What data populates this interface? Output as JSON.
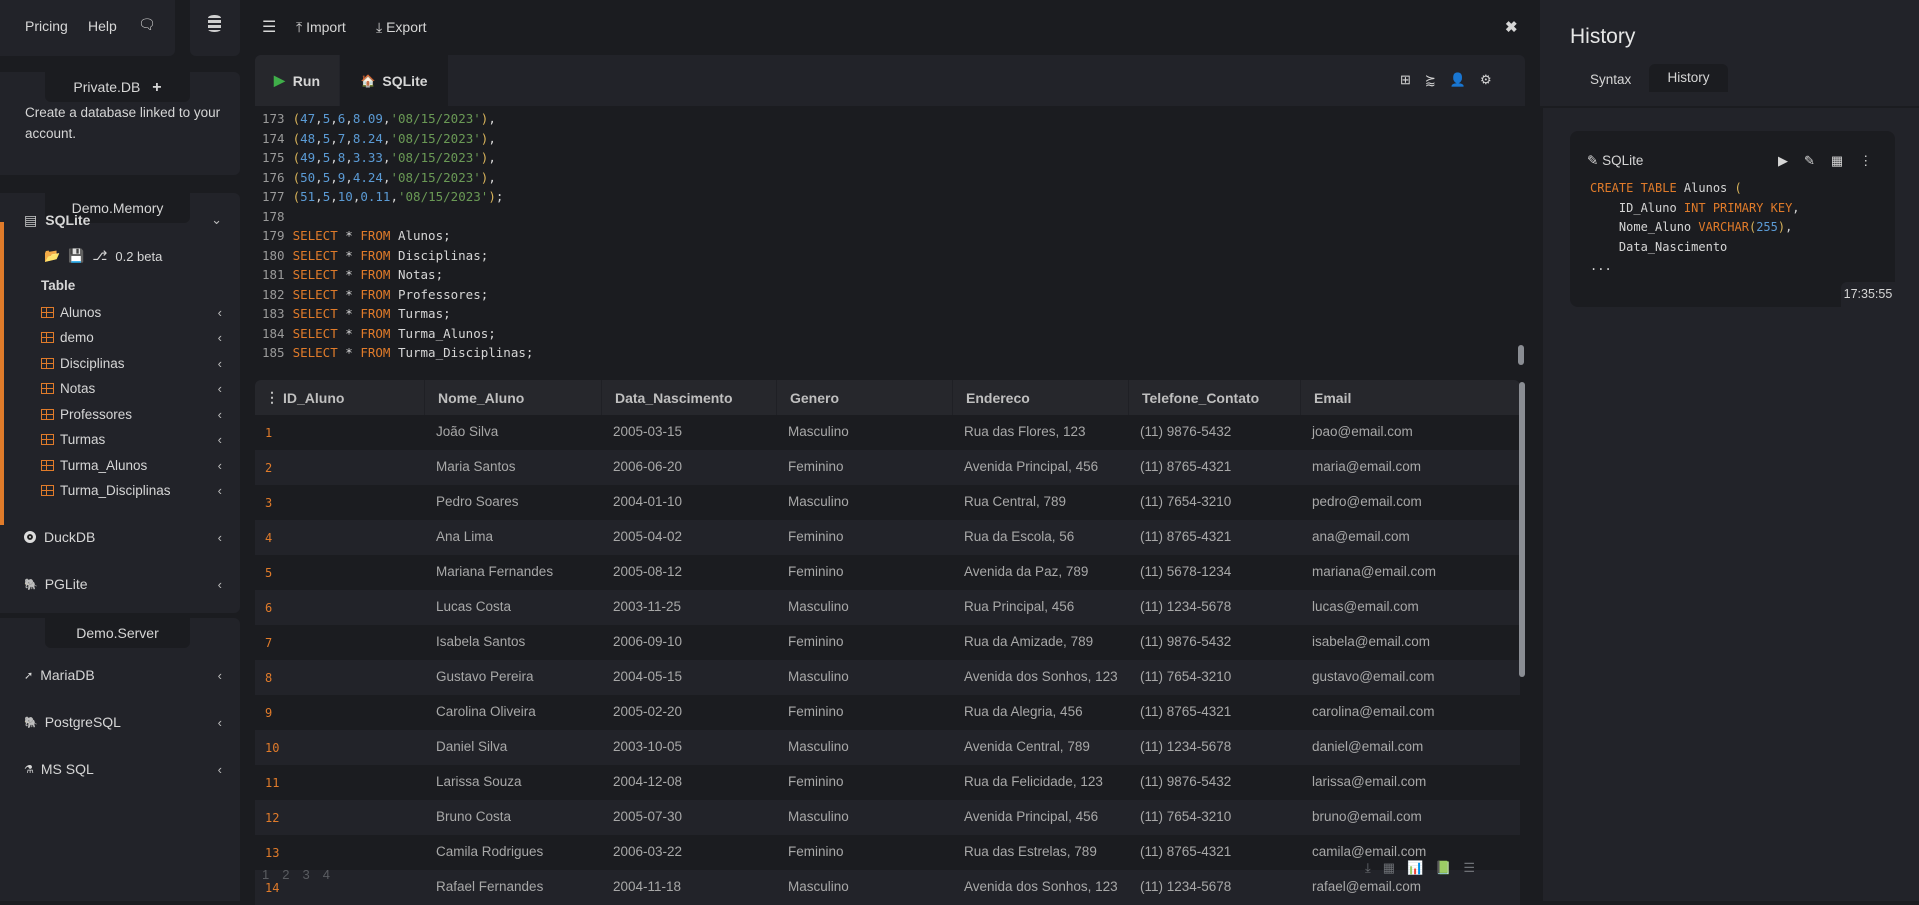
{
  "topnav": {
    "pricing": "Pricing",
    "help": "Help"
  },
  "sidebar": {
    "private_db": "Private.DB",
    "private_desc": "Create a database linked to your account.",
    "demo_memory": "Demo.Memory",
    "sqlite": "SQLite",
    "version": "0.2 beta",
    "table_label": "Table",
    "tables": [
      "Alunos",
      "demo",
      "Disciplinas",
      "Notas",
      "Professores",
      "Turmas",
      "Turma_Alunos",
      "Turma_Disciplinas"
    ],
    "duckdb": "DuckDB",
    "pglite": "PGLite",
    "demo_server": "Demo.Server",
    "mariadb": "MariaDB",
    "postgresql": "PostgreSQL",
    "mssql": "MS SQL"
  },
  "toolbar": {
    "import": "Import",
    "export": "Export"
  },
  "editor": {
    "run": "Run",
    "tab": "SQLite",
    "lines": [
      {
        "n": "173",
        "t": [
          [
            "paren",
            "("
          ],
          [
            "num",
            "47"
          ],
          [
            "",
            ","
          ],
          [
            "num",
            "5"
          ],
          [
            "",
            ","
          ],
          [
            "num",
            "6"
          ],
          [
            "",
            ","
          ],
          [
            "num",
            "8.09"
          ],
          [
            "",
            ","
          ],
          [
            "str",
            "'08/15/2023'"
          ],
          [
            "paren",
            ")"
          ],
          [
            "",
            ","
          ]
        ]
      },
      {
        "n": "174",
        "t": [
          [
            "paren",
            "("
          ],
          [
            "num",
            "48"
          ],
          [
            "",
            ","
          ],
          [
            "num",
            "5"
          ],
          [
            "",
            ","
          ],
          [
            "num",
            "7"
          ],
          [
            "",
            ","
          ],
          [
            "num",
            "8.24"
          ],
          [
            "",
            ","
          ],
          [
            "str",
            "'08/15/2023'"
          ],
          [
            "paren",
            ")"
          ],
          [
            "",
            ","
          ]
        ]
      },
      {
        "n": "175",
        "t": [
          [
            "paren",
            "("
          ],
          [
            "num",
            "49"
          ],
          [
            "",
            ","
          ],
          [
            "num",
            "5"
          ],
          [
            "",
            ","
          ],
          [
            "num",
            "8"
          ],
          [
            "",
            ","
          ],
          [
            "num",
            "3.33"
          ],
          [
            "",
            ","
          ],
          [
            "str",
            "'08/15/2023'"
          ],
          [
            "paren",
            ")"
          ],
          [
            "",
            ","
          ]
        ]
      },
      {
        "n": "176",
        "t": [
          [
            "paren",
            "("
          ],
          [
            "num",
            "50"
          ],
          [
            "",
            ","
          ],
          [
            "num",
            "5"
          ],
          [
            "",
            ","
          ],
          [
            "num",
            "9"
          ],
          [
            "",
            ","
          ],
          [
            "num",
            "4.24"
          ],
          [
            "",
            ","
          ],
          [
            "str",
            "'08/15/2023'"
          ],
          [
            "paren",
            ")"
          ],
          [
            "",
            ","
          ]
        ]
      },
      {
        "n": "177",
        "t": [
          [
            "paren",
            "("
          ],
          [
            "num",
            "51"
          ],
          [
            "",
            ","
          ],
          [
            "num",
            "5"
          ],
          [
            "",
            ","
          ],
          [
            "num",
            "10"
          ],
          [
            "",
            ","
          ],
          [
            "num",
            "0.11"
          ],
          [
            "",
            ","
          ],
          [
            "str",
            "'08/15/2023'"
          ],
          [
            "paren",
            ")"
          ],
          [
            "",
            ";"
          ]
        ]
      },
      {
        "n": "178",
        "t": []
      },
      {
        "n": "179",
        "t": [
          [
            "kw",
            "SELECT"
          ],
          [
            "",
            " * "
          ],
          [
            "kw",
            "FROM"
          ],
          [
            "",
            " Alunos;"
          ]
        ]
      },
      {
        "n": "180",
        "t": [
          [
            "kw",
            "SELECT"
          ],
          [
            "",
            " * "
          ],
          [
            "kw",
            "FROM"
          ],
          [
            "",
            " Disciplinas;"
          ]
        ]
      },
      {
        "n": "181",
        "t": [
          [
            "kw",
            "SELECT"
          ],
          [
            "",
            " * "
          ],
          [
            "kw",
            "FROM"
          ],
          [
            "",
            " Notas;"
          ]
        ]
      },
      {
        "n": "182",
        "t": [
          [
            "kw",
            "SELECT"
          ],
          [
            "",
            " * "
          ],
          [
            "kw",
            "FROM"
          ],
          [
            "",
            " Professores;"
          ]
        ]
      },
      {
        "n": "183",
        "t": [
          [
            "kw",
            "SELECT"
          ],
          [
            "",
            " * "
          ],
          [
            "kw",
            "FROM"
          ],
          [
            "",
            " Turmas;"
          ]
        ]
      },
      {
        "n": "184",
        "t": [
          [
            "kw",
            "SELECT"
          ],
          [
            "",
            " * "
          ],
          [
            "kw",
            "FROM"
          ],
          [
            "",
            " Turma_Alunos;"
          ]
        ]
      },
      {
        "n": "185",
        "t": [
          [
            "kw",
            "SELECT"
          ],
          [
            "",
            " * "
          ],
          [
            "kw",
            "FROM"
          ],
          [
            "",
            " Turma_Disciplinas;"
          ]
        ]
      }
    ]
  },
  "results": {
    "columns": [
      "ID_Aluno",
      "Nome_Aluno",
      "Data_Nascimento",
      "Genero",
      "Endereco",
      "Telefone_Contato",
      "Email"
    ],
    "rows": [
      [
        "1",
        "João Silva",
        "2005-03-15",
        "Masculino",
        "Rua das Flores, 123",
        "(11) 9876-5432",
        "joao@email.com"
      ],
      [
        "2",
        "Maria Santos",
        "2006-06-20",
        "Feminino",
        "Avenida Principal, 456",
        "(11) 8765-4321",
        "maria@email.com"
      ],
      [
        "3",
        "Pedro Soares",
        "2004-01-10",
        "Masculino",
        "Rua Central, 789",
        "(11) 7654-3210",
        "pedro@email.com"
      ],
      [
        "4",
        "Ana Lima",
        "2005-04-02",
        "Feminino",
        "Rua da Escola, 56",
        "(11) 8765-4321",
        "ana@email.com"
      ],
      [
        "5",
        "Mariana Fernandes",
        "2005-08-12",
        "Feminino",
        "Avenida da Paz, 789",
        "(11) 5678-1234",
        "mariana@email.com"
      ],
      [
        "6",
        "Lucas Costa",
        "2003-11-25",
        "Masculino",
        "Rua Principal, 456",
        "(11) 1234-5678",
        "lucas@email.com"
      ],
      [
        "7",
        "Isabela Santos",
        "2006-09-10",
        "Feminino",
        "Rua da Amizade, 789",
        "(11) 9876-5432",
        "isabela@email.com"
      ],
      [
        "8",
        "Gustavo Pereira",
        "2004-05-15",
        "Masculino",
        "Avenida dos Sonhos, 123",
        "(11) 7654-3210",
        "gustavo@email.com"
      ],
      [
        "9",
        "Carolina Oliveira",
        "2005-02-20",
        "Feminino",
        "Rua da Alegria, 456",
        "(11) 8765-4321",
        "carolina@email.com"
      ],
      [
        "10",
        "Daniel Silva",
        "2003-10-05",
        "Masculino",
        "Avenida Central, 789",
        "(11) 1234-5678",
        "daniel@email.com"
      ],
      [
        "11",
        "Larissa Souza",
        "2004-12-08",
        "Feminino",
        "Rua da Felicidade, 123",
        "(11) 9876-5432",
        "larissa@email.com"
      ],
      [
        "12",
        "Bruno Costa",
        "2005-07-30",
        "Masculino",
        "Avenida Principal, 456",
        "(11) 7654-3210",
        "bruno@email.com"
      ],
      [
        "13",
        "Camila Rodrigues",
        "2006-03-22",
        "Feminino",
        "Rua das Estrelas, 789",
        "(11) 8765-4321",
        "camila@email.com"
      ],
      [
        "14",
        "Rafael Fernandes",
        "2004-11-18",
        "Masculino",
        "Avenida dos Sonhos, 123",
        "(11) 1234-5678",
        "rafael@email.com"
      ]
    ],
    "pages": [
      "1",
      "2",
      "3",
      "4"
    ]
  },
  "history": {
    "title": "History",
    "tabs": [
      "Syntax",
      "History"
    ],
    "active_tab": "History",
    "card": {
      "engine": "SQLite",
      "time": "17:35:55",
      "code": [
        [
          [
            "kw",
            "CREATE TABLE"
          ],
          [
            "",
            " Alunos "
          ],
          [
            "paren",
            "("
          ]
        ],
        [
          [
            "",
            "    ID_Aluno "
          ],
          [
            "kw",
            "INT PRIMARY KEY"
          ],
          [
            "",
            ","
          ]
        ],
        [
          [
            "",
            "    Nome_Aluno "
          ],
          [
            "kw",
            "VARCHAR"
          ],
          [
            "paren",
            "("
          ],
          [
            "num",
            "255"
          ],
          [
            "paren",
            ")"
          ],
          [
            "",
            ","
          ]
        ],
        [
          [
            "",
            "    Data_Nascimento"
          ]
        ],
        [
          [
            "",
            "..."
          ]
        ]
      ]
    }
  },
  "colors": {
    "accent": "#e07b2a",
    "run": "#3fae49"
  }
}
